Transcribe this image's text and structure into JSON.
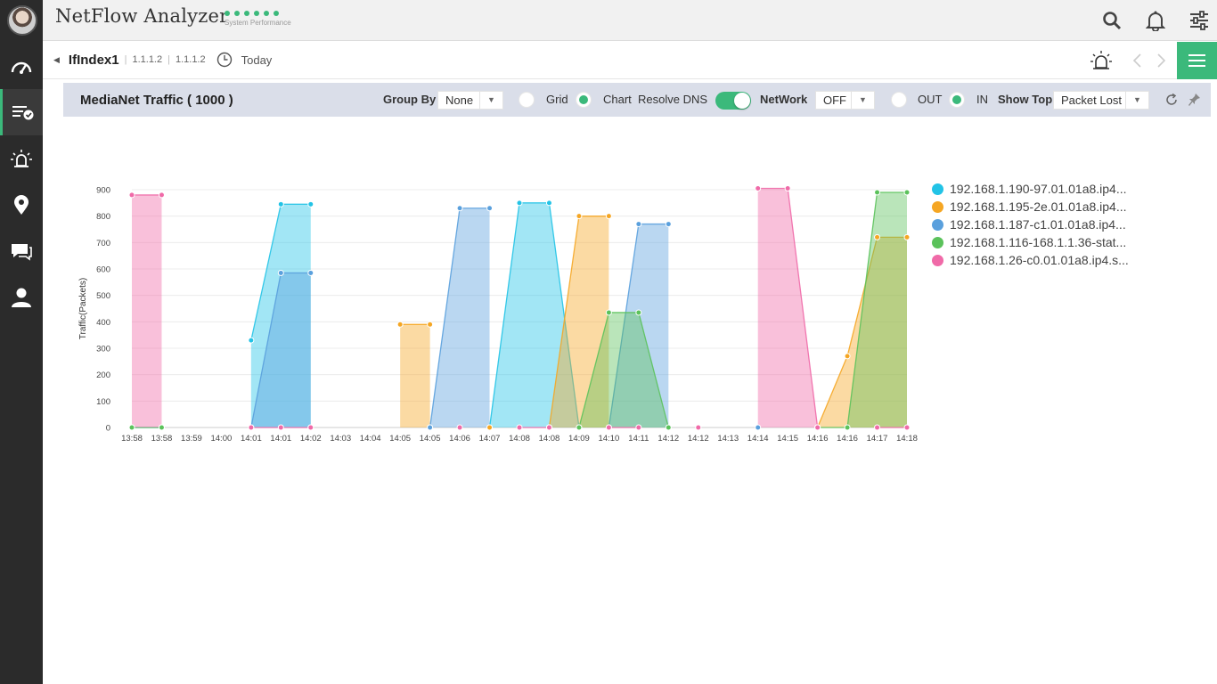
{
  "app": {
    "title": "NetFlow Analyzer",
    "perf_label": "System Performance"
  },
  "rail": {
    "items": [
      "dashboard-icon",
      "reports-icon",
      "alarms-icon",
      "location-icon",
      "chat-icon",
      "user-icon"
    ],
    "active": "reports-icon"
  },
  "breadcrumb": {
    "interface": "IfIndex1",
    "ip1": "1.1.1.2",
    "ip2": "1.1.1.2",
    "period": "Today"
  },
  "toolbar": {
    "title": "MediaNet Traffic ( 1000 )",
    "group_by_label": "Group By",
    "group_by_value": "None",
    "grid_label": "Grid",
    "chart_label": "Chart",
    "resolve_dns_label": "Resolve DNS",
    "network_label": "NetWork",
    "network_value": "OFF",
    "out_label": "OUT",
    "in_label": "IN",
    "show_top_label": "Show Top",
    "show_top_value": "Packet Lost"
  },
  "colors": {
    "accent": "#3bb97b",
    "toolbar_bg": "#dadee9"
  },
  "chart_data": {
    "type": "area",
    "title": "",
    "ylabel": "Traffic(Packets)",
    "ylim": [
      0,
      900
    ],
    "yticks": [
      0,
      100,
      200,
      300,
      400,
      500,
      600,
      700,
      800,
      900
    ],
    "x": [
      "13:58",
      "13:58",
      "13:59",
      "14:00",
      "14:01",
      "14:01",
      "14:02",
      "14:03",
      "14:04",
      "14:05",
      "14:05",
      "14:06",
      "14:07",
      "14:08",
      "14:08",
      "14:09",
      "14:10",
      "14:11",
      "14:12",
      "14:12",
      "14:13",
      "14:14",
      "14:15",
      "14:16",
      "14:16",
      "14:17",
      "14:18"
    ],
    "series": [
      {
        "name": "192.168.1.190-97.01.01a8.ip4...",
        "color": "#22c3e6",
        "values": [
          0,
          0,
          null,
          null,
          330,
          845,
          845,
          null,
          null,
          null,
          0,
          null,
          0,
          850,
          850,
          0,
          null,
          null,
          null,
          null,
          null,
          null,
          null,
          null,
          null,
          null,
          null
        ]
      },
      {
        "name": "192.168.1.195-2e.01.01a8.ip4...",
        "color": "#f5a623",
        "values": [
          null,
          null,
          null,
          null,
          null,
          null,
          0,
          null,
          null,
          390,
          390,
          null,
          0,
          null,
          0,
          800,
          800,
          null,
          null,
          0,
          null,
          null,
          null,
          0,
          270,
          720,
          720
        ]
      },
      {
        "name": "192.168.1.187-c1.01.01a8.ip4...",
        "color": "#5aa0dd",
        "values": [
          null,
          0,
          null,
          null,
          0,
          585,
          585,
          null,
          null,
          null,
          0,
          830,
          830,
          null,
          0,
          null,
          0,
          770,
          770,
          null,
          null,
          0,
          null,
          0,
          null,
          null,
          null
        ]
      },
      {
        "name": "192.168.1.116-168.1.1.36-stat...",
        "color": "#5bc25b",
        "values": [
          0,
          0,
          null,
          null,
          null,
          null,
          null,
          null,
          null,
          null,
          null,
          null,
          null,
          null,
          null,
          0,
          435,
          435,
          0,
          null,
          null,
          null,
          null,
          0,
          0,
          890,
          890
        ]
      },
      {
        "name": "192.168.1.26-c0.01.01a8.ip4.s...",
        "color": "#f06aa8",
        "values": [
          880,
          880,
          null,
          null,
          0,
          0,
          0,
          null,
          null,
          null,
          null,
          0,
          null,
          0,
          0,
          null,
          0,
          0,
          null,
          0,
          null,
          905,
          905,
          0,
          null,
          0,
          0
        ]
      }
    ]
  }
}
